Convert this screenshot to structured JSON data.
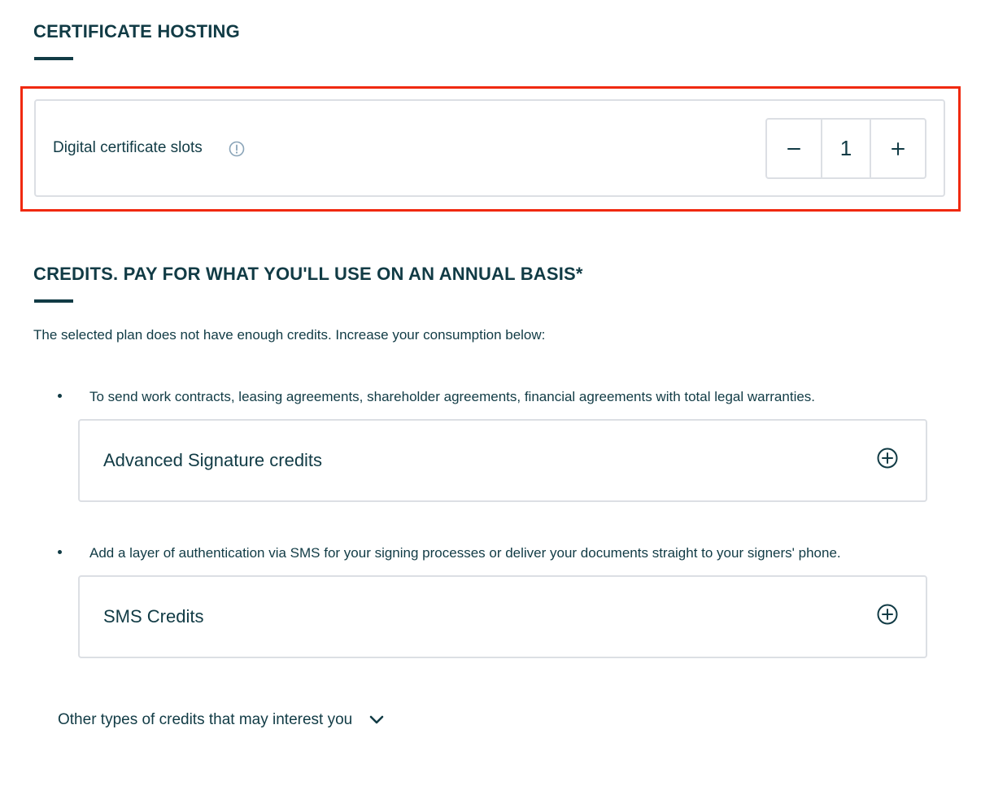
{
  "certificate_hosting": {
    "title": "CERTIFICATE HOSTING",
    "slots_label": "Digital certificate slots",
    "info_icon": "info-circle-icon",
    "stepper": {
      "decrement_icon": "minus-icon",
      "value": "1",
      "increment_icon": "plus-icon"
    }
  },
  "credits": {
    "title": "CREDITS. PAY FOR WHAT YOU'LL USE ON AN ANNUAL BASIS*",
    "intro": "The selected plan does not have enough credits. Increase your consumption below:",
    "items": [
      {
        "description": "To send work contracts, leasing agreements, shareholder agreements, financial agreements with total legal warranties.",
        "card_title": "Advanced Signature credits",
        "icon": "plus-circle-icon"
      },
      {
        "description": "Add a layer of authentication via SMS for your signing processes or deliver your documents straight to your signers' phone.",
        "card_title": "SMS Credits",
        "icon": "plus-circle-icon"
      }
    ],
    "other_link": "Other types of credits that may interest you",
    "other_icon": "chevron-down-icon"
  },
  "colors": {
    "text": "#113b45",
    "border": "#dcdfe4",
    "highlight": "#f0290f",
    "info_icon": "#8aa4b8"
  }
}
